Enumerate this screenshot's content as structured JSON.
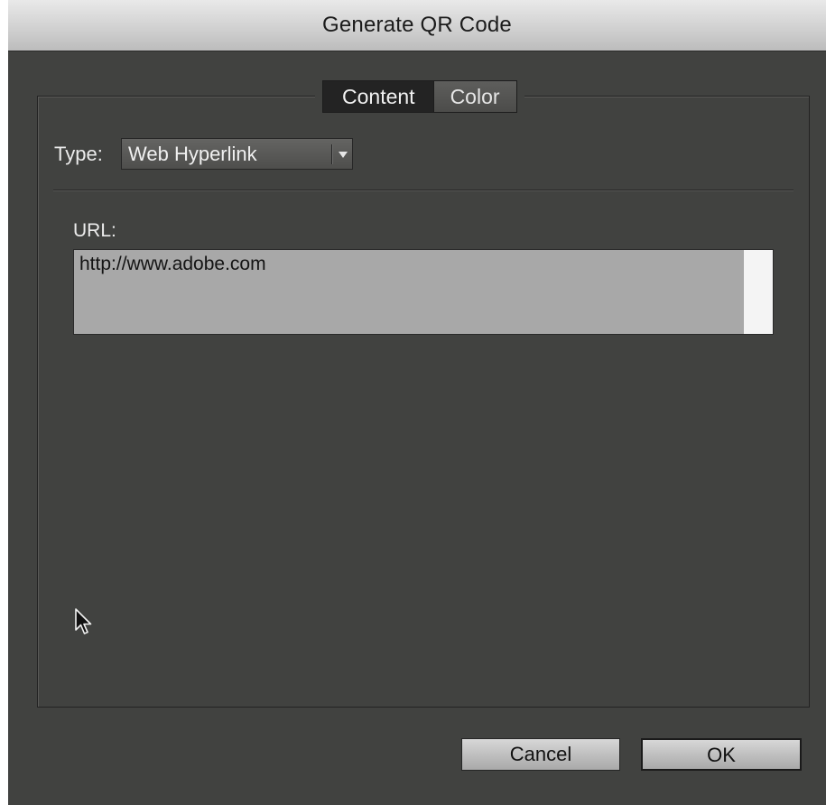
{
  "window": {
    "title": "Generate QR Code"
  },
  "tabs": [
    {
      "label": "Content",
      "active": true
    },
    {
      "label": "Color",
      "active": false
    }
  ],
  "type_field": {
    "label": "Type:",
    "selected": "Web Hyperlink"
  },
  "url_field": {
    "label": "URL:",
    "value": "http://www.adobe.com"
  },
  "buttons": {
    "cancel": "Cancel",
    "ok": "OK"
  },
  "icons": {
    "dropdown": "chevron-down-icon",
    "cursor": "mouse-pointer-icon"
  },
  "colors": {
    "dialog_bg": "#414240",
    "title_bar": "#cfcfcf",
    "active_tab": "#232323",
    "field_bg": "#a8a8a8"
  }
}
